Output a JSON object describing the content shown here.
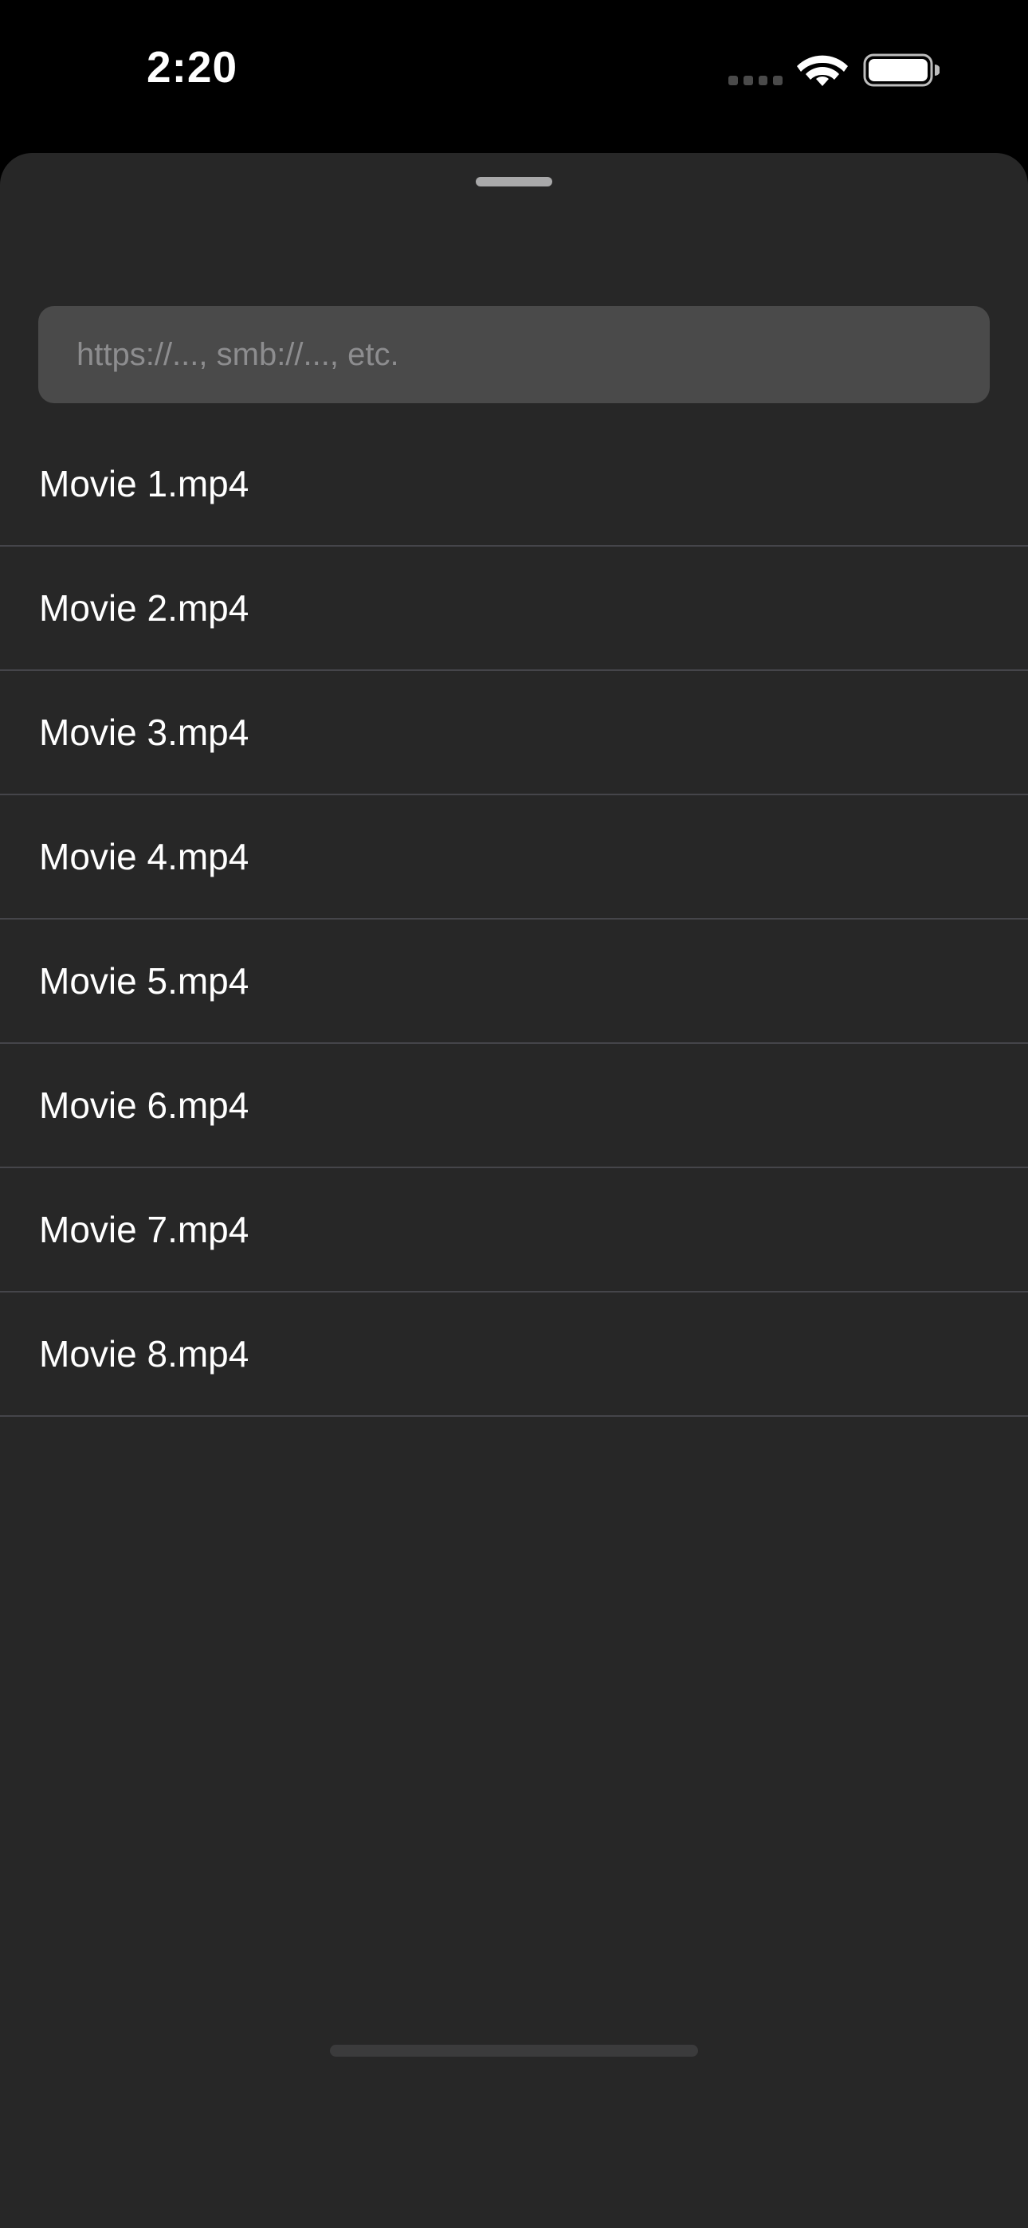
{
  "status_bar": {
    "time": "2:20",
    "icons": [
      "cellular-signal-icon",
      "wifi-icon",
      "battery-icon"
    ]
  },
  "sheet": {
    "url_field": {
      "value": "",
      "placeholder": "https://..., smb://..., etc."
    },
    "files": [
      {
        "name": "Movie 1.mp4"
      },
      {
        "name": "Movie 2.mp4"
      },
      {
        "name": "Movie 3.mp4"
      },
      {
        "name": "Movie 4.mp4"
      },
      {
        "name": "Movie 5.mp4"
      },
      {
        "name": "Movie 6.mp4"
      },
      {
        "name": "Movie 7.mp4"
      },
      {
        "name": "Movie 8.mp4"
      }
    ]
  },
  "colors": {
    "background": "#000000",
    "sheet_background": "#272727",
    "field_background": "#4a4a4a",
    "placeholder_text": "#8d8d8f",
    "text": "#ffffff",
    "separator": "#45454a"
  }
}
